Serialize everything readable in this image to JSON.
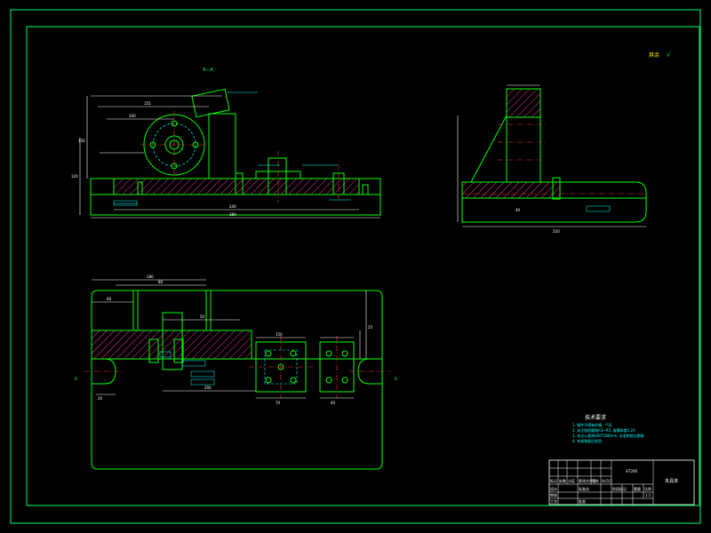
{
  "colors": {
    "background": "#000000",
    "frame": "#00ff66",
    "outline": "#00ff00",
    "dimension": "#ffffff",
    "annotation": "#00ffff",
    "hatch": "#ff33aa",
    "section_mark": "#ffff00",
    "center_line": "#ff3333",
    "text_yellow": "#ffff00"
  },
  "labels": {
    "section_a": "A—A",
    "section_b_left": "B",
    "section_b_right": "B",
    "roughness_symbol": "√",
    "roughness_label": "其余"
  },
  "dimensions": {
    "front_total": "380",
    "front_1": "240",
    "front_2": "155",
    "front_3": "100",
    "front_height_1": "150",
    "front_height_2": "120",
    "side_total": "220",
    "side_1": "40",
    "top_1": "180",
    "top_2": "80",
    "top_3": "60",
    "top_4": "50",
    "top_5": "200",
    "top_6": "70",
    "top_7": "40",
    "top_8": "25",
    "top_9": "20",
    "top_10": "150"
  },
  "tech_requirements": {
    "heading": "技术要求",
    "lines": [
      "1. 铸件不得有砂眼、气孔",
      "2. 未注铸造圆角R3~R5, 拔模斜度1:20",
      "3. 未注公差按GB/T1804-m, 去毛刺锐边倒角",
      "4. 夹具装配后检验"
    ]
  },
  "title_block": {
    "material": "HT200",
    "name": "夹具体",
    "scale": "1:1",
    "row_labels": [
      "标记",
      "处数",
      "分区",
      "更改文件号",
      "签名",
      "年月日"
    ],
    "bottom_labels": [
      "设计",
      "标准化",
      "审核",
      "工艺",
      "批准"
    ],
    "stage_labels": [
      "阶段标记",
      "重量",
      "比例"
    ]
  }
}
